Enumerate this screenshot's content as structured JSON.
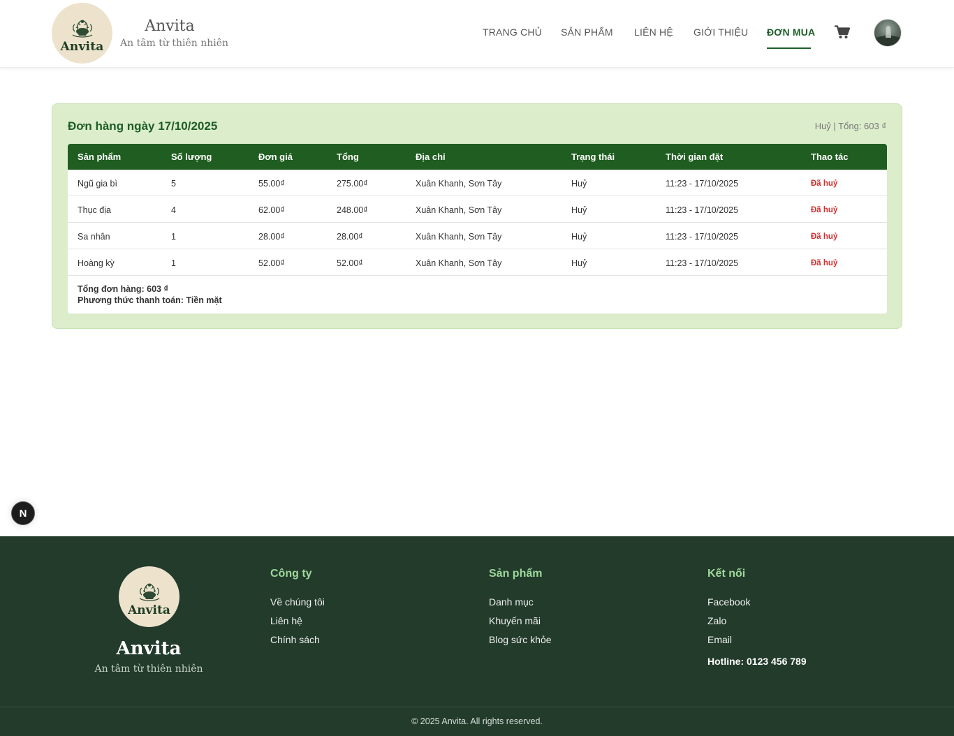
{
  "header": {
    "logo_text": "Anvita",
    "brand_name": "Anvita",
    "brand_tagline": "An tâm từ thiên nhiên",
    "nav": [
      {
        "label": "TRANG CHỦ"
      },
      {
        "label": "SẢN PHẨM"
      },
      {
        "label": "LIÊN HỆ"
      },
      {
        "label": "GIỚI THIỆU"
      },
      {
        "label": "ĐƠN MUA"
      }
    ],
    "active_nav": "ĐƠN MUA",
    "cart_icon": "cart-icon",
    "avatar_icon": "user-avatar"
  },
  "order": {
    "title": "Đơn hàng ngày 17/10/2025",
    "meta": "Huỷ | Tổng: 603 ₫",
    "columns": [
      "Sản phẩm",
      "Số lượng",
      "Đơn giá",
      "Tổng",
      "Địa chỉ",
      "Trạng thái",
      "Thời gian đặt",
      "Thao tác"
    ],
    "rows": [
      {
        "product": "Ngũ gia bì",
        "qty": "5",
        "price": "55.00₫",
        "total": "275.00₫",
        "address": "Xuân Khanh, Sơn Tây",
        "status": "Huỷ",
        "time": "11:23 - 17/10/2025",
        "action": "Đã huỷ"
      },
      {
        "product": "Thục địa",
        "qty": "4",
        "price": "62.00₫",
        "total": "248.00₫",
        "address": "Xuân Khanh, Sơn Tây",
        "status": "Huỷ",
        "time": "11:23 - 17/10/2025",
        "action": "Đã huỷ"
      },
      {
        "product": "Sa nhân",
        "qty": "1",
        "price": "28.00₫",
        "total": "28.00₫",
        "address": "Xuân Khanh, Sơn Tây",
        "status": "Huỷ",
        "time": "11:23 - 17/10/2025",
        "action": "Đã huỷ"
      },
      {
        "product": "Hoàng kỳ",
        "qty": "1",
        "price": "52.00₫",
        "total": "52.00₫",
        "address": "Xuân Khanh, Sơn Tây",
        "status": "Huỷ",
        "time": "11:23 - 17/10/2025",
        "action": "Đã huỷ"
      }
    ],
    "summary_total": "Tổng đơn hàng: 603 ₫",
    "summary_payment": "Phương thức thanh toán: Tiền mặt"
  },
  "next_badge": "N",
  "footer": {
    "logo_text": "Anvita",
    "brand_name": "Anvita",
    "brand_tagline": "An tâm từ thiên nhiên",
    "columns": [
      {
        "title": "Công ty",
        "links": [
          "Về chúng tôi",
          "Liên hệ",
          "Chính sách"
        ]
      },
      {
        "title": "Sản phẩm",
        "links": [
          "Danh mục",
          "Khuyến mãi",
          "Blog sức khỏe"
        ]
      },
      {
        "title": "Kết nối",
        "links": [
          "Facebook",
          "Zalo",
          "Email"
        ]
      }
    ],
    "hotline": "Hotline: 0123 456 789",
    "copyright": "© 2025 Anvita. All rights reserved."
  },
  "colors": {
    "primary": "#1d5e27",
    "header_row": "#1f5e20",
    "card_bg": "#dcedcb",
    "footer_bg": "#223b2b",
    "cancel": "#d32f2f",
    "footer_heading": "#9fd79a",
    "logo_bg": "#ede3cc"
  }
}
